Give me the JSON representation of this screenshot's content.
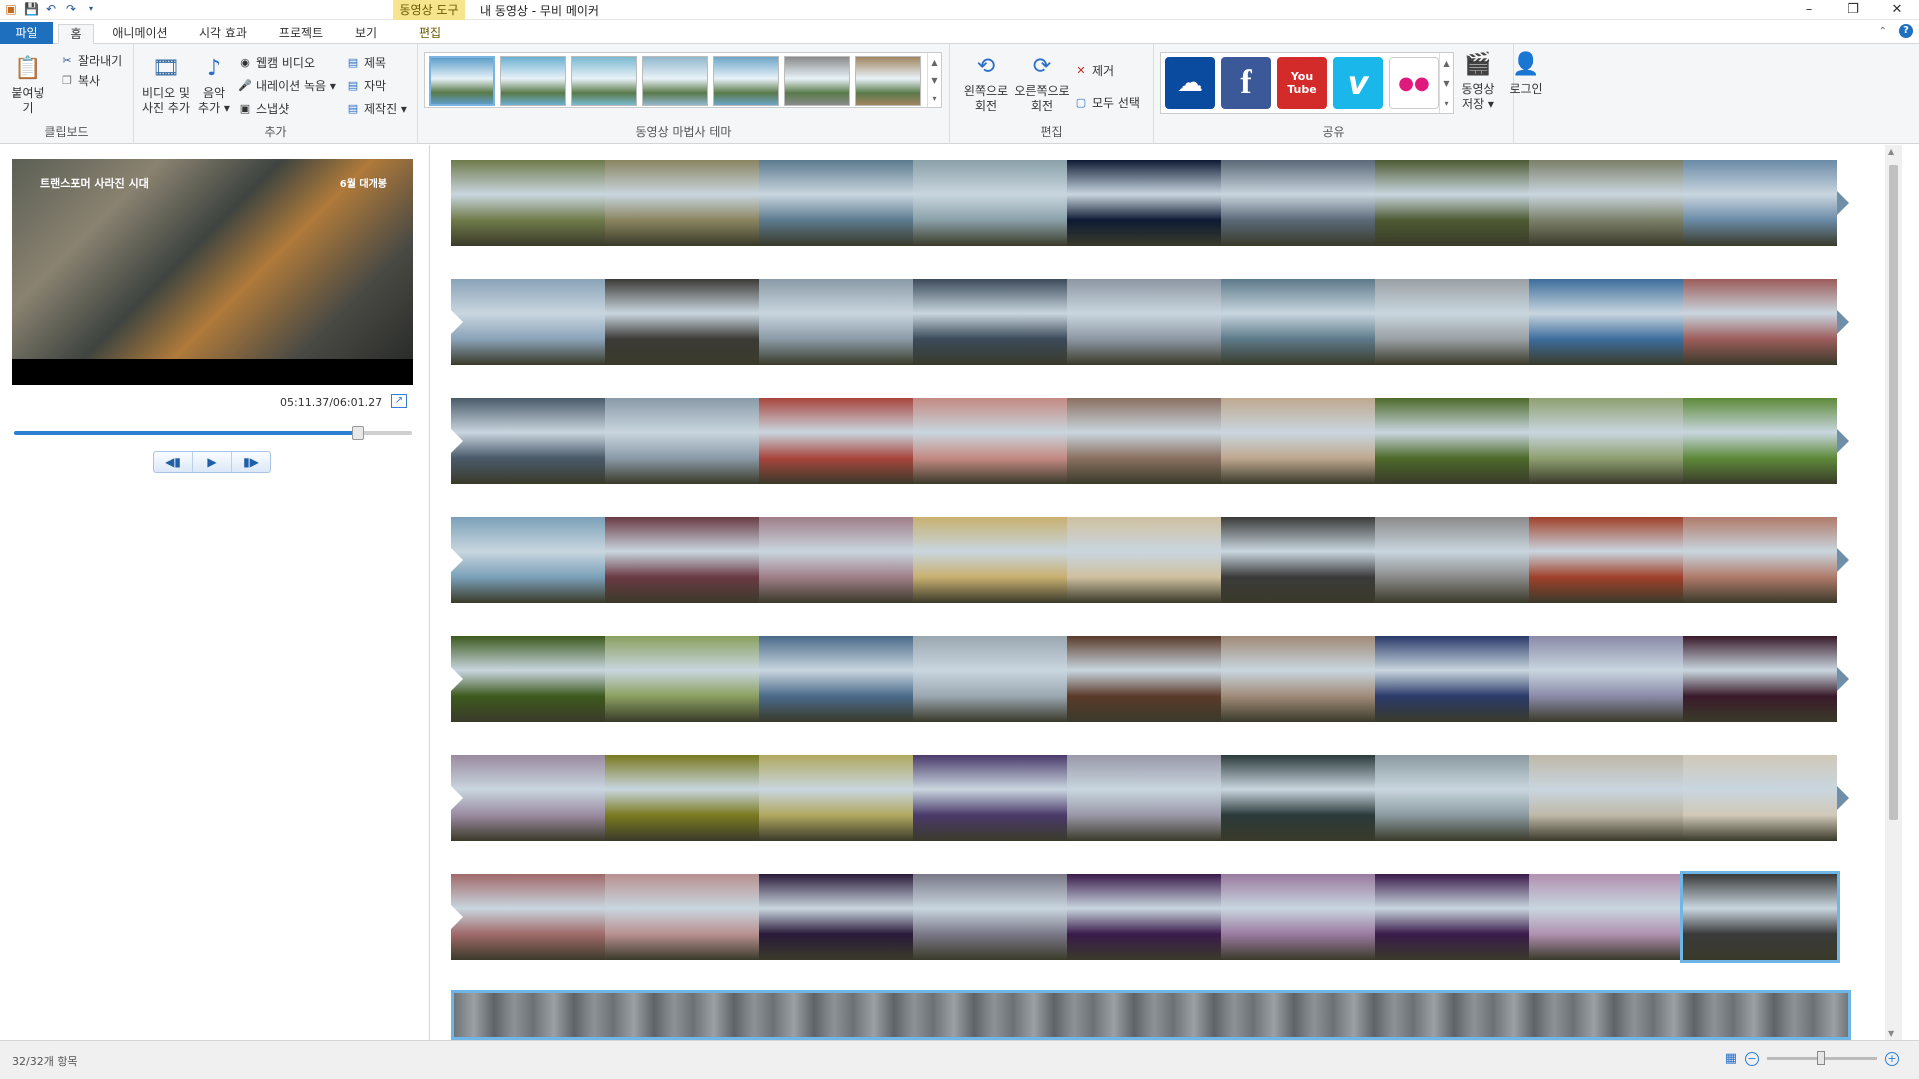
{
  "title_bar": {
    "context_tab_header": "동영상 도구",
    "app_title": "내 동영상 - 무비 메이커",
    "qat_icons": [
      "app-icon",
      "save-icon",
      "undo-icon",
      "redo-icon",
      "dropdown-icon"
    ],
    "minimize": "–",
    "maximize": "❐",
    "close": "✕"
  },
  "tabs": {
    "file": "파일",
    "home": "홈",
    "animation": "애니메이션",
    "visual_effects": "시각 효과",
    "project": "프로젝트",
    "view": "보기",
    "edit": "편집"
  },
  "ribbon": {
    "clipboard": {
      "label": "클립보드",
      "paste": "붙여넣기",
      "cut": "잘라내기",
      "copy": "복사"
    },
    "add": {
      "label": "추가",
      "add_videos_line1": "비디오 및",
      "add_videos_line2": "사진 추가",
      "add_music_line1": "음악",
      "add_music_line2": "추가 ▾",
      "webcam": "웹캠 비디오",
      "narration": "내레이션 녹음 ▾",
      "snapshot": "스냅샷",
      "title": "제목",
      "caption": "자막",
      "credits": "제작진 ▾"
    },
    "themes": {
      "label": "동영상 마법사 테마",
      "items": [
        "theme-1",
        "theme-2",
        "theme-3",
        "theme-4",
        "theme-5",
        "theme-6",
        "theme-7"
      ],
      "colors": [
        "#5e9ec9",
        "#6cb0d2",
        "#7ab9cf",
        "#92b7cd",
        "#6ea6c8",
        "#8a8a8a",
        "#a08560"
      ]
    },
    "edit": {
      "label": "편집",
      "rotate_left_line1": "왼쪽으로",
      "rotate_left_line2": "회전",
      "rotate_right_line1": "오른쪽으로",
      "rotate_right_line2": "회전",
      "remove": "제거",
      "select_all": "모두 선택"
    },
    "share": {
      "label": "공유",
      "services": [
        {
          "name": "onedrive",
          "glyph": "☁",
          "color": "#0a4a9f"
        },
        {
          "name": "facebook",
          "glyph": "f",
          "color": "#3b5998"
        },
        {
          "name": "youtube",
          "glyph": "You Tube",
          "color": "#d32a2a"
        },
        {
          "name": "vimeo",
          "glyph": "v",
          "color": "#1ab7ea"
        },
        {
          "name": "flickr",
          "glyph": "●●",
          "color": "#ffffff"
        }
      ],
      "save_movie_line1": "동영상",
      "save_movie_line2": "저장 ▾",
      "sign_in": "로그인"
    }
  },
  "preview": {
    "caption_left": "트랜스포머 사라진 시대",
    "caption_right": "6월 대개봉",
    "timecode": "05:11.37/06:01.27",
    "progress": 0.864,
    "controls": [
      "◀▮",
      "▶",
      "▮▶"
    ]
  },
  "storyboard": {
    "rows": [
      [
        "#6f7a4a",
        "#8a8460",
        "#5c7a8e",
        "#8aa0a8",
        "#0d1a33",
        "#5a6878",
        "#4d5a32",
        "#7b8069",
        "#6a8aa6"
      ],
      [
        "#8aa3b8",
        "#3c3a36",
        "#8a9aa6",
        "#3b4a5a",
        "#8d97a3",
        "#5d7a8a",
        "#9aa0a4",
        "#3d6d9c",
        "#9c5c5a"
      ],
      [
        "#4a5a6a",
        "#8a9aa8",
        "#a8453c",
        "#c48a82",
        "#8a7060",
        "#bfa890",
        "#4d6a2a",
        "#8ea070",
        "#5d8a3a"
      ],
      [
        "#7aa0b8",
        "#6a3a44",
        "#a07e88",
        "#c8b070",
        "#cfc0a0",
        "#3a3a3a",
        "#8a8a8a",
        "#a0402a",
        "#b07a6a"
      ],
      [
        "#3d5a1e",
        "#8aa060",
        "#4a6a8a",
        "#9aa6b0",
        "#5a3a2a",
        "#a08a78",
        "#2a3a6a",
        "#8a8aa8",
        "#3a1a2a"
      ],
      [
        "#9a8aa0",
        "#7a7a20",
        "#b0a860",
        "#4a3a6a",
        "#9a98a8",
        "#2a3a3a",
        "#8a9aa0",
        "#bfb8a8",
        "#d0c8b8"
      ],
      [
        "#a06a6a",
        "#b89090",
        "#2a1a3a",
        "#7a7888",
        "#3a1a4a",
        "#9a7aa0",
        "#3a1a4a",
        "#b090b0",
        "#3a3a3a"
      ]
    ],
    "selected_clip": "7-9"
  },
  "status": {
    "count": "32/32개 항목"
  }
}
